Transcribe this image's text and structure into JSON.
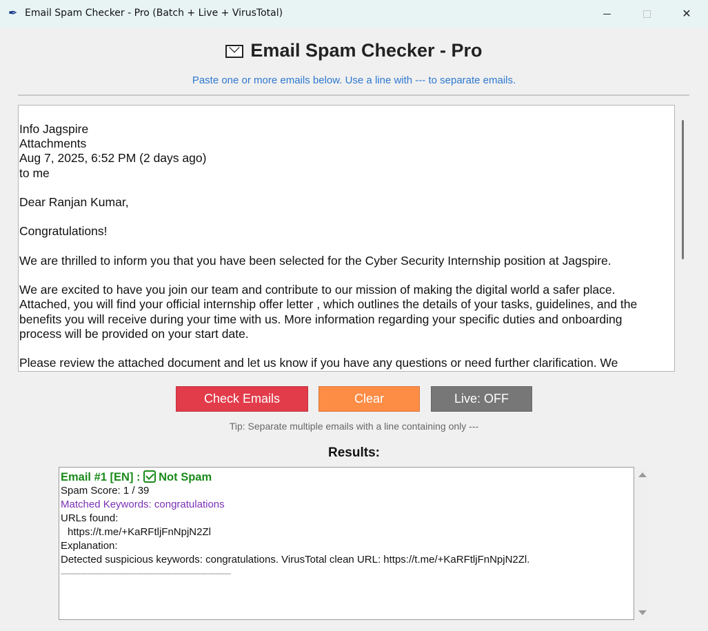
{
  "window": {
    "title": "Email Spam Checker - Pro (Batch + Live + VirusTotal)"
  },
  "header": {
    "icon": "envelope-icon",
    "title": "Email Spam Checker - Pro",
    "subtitle": "Paste one or more emails below. Use a line with --- to separate emails."
  },
  "input": {
    "text": "Info Jagspire\nAttachments\nAug 7, 2025, 6:52 PM (2 days ago)\nto me\n\nDear Ranjan Kumar,\n\nCongratulations!\n\nWe are thrilled to inform you that you have been selected for the Cyber Security Internship position at Jagspire.\n\nWe are excited to have you join our team and contribute to our mission of making the digital world a safer place.\nAttached, you will find your official internship offer letter , which outlines the details of your tasks, guidelines, and the\nbenefits you will receive during your time with us. More information regarding your specific duties and onboarding\nprocess will be provided on your start date.\n\nPlease review the attached document and let us know if you have any questions or need further clarification. We"
  },
  "buttons": {
    "check": "Check Emails",
    "clear": "Clear",
    "live": "Live: OFF"
  },
  "colors": {
    "check": "#e23b4a",
    "clear": "#fd8c45",
    "live": "#777777",
    "subtitle": "#2e78d0",
    "not_spam": "#1a8a1a",
    "keywords": "#7a2fb5"
  },
  "tip": "Tip: Separate multiple emails with a line containing only ---",
  "results": {
    "label": "Results:",
    "heading_prefix": "Email #1 [EN] :",
    "heading_status": "Not Spam",
    "score": "Spam Score: 1 / 39",
    "keywords": "Matched Keywords: congratulations",
    "urls_label": "URLs found:",
    "url": "https://t.me/+KaRFtljFnNpjN2Zl",
    "explanation_label": "Explanation:",
    "explanation": "Detected suspicious keywords: congratulations. VirusTotal clean URL: https://t.me/+KaRFtljFnNpjN2Zl.",
    "separator": "------------------------------------------------------------------------------"
  }
}
